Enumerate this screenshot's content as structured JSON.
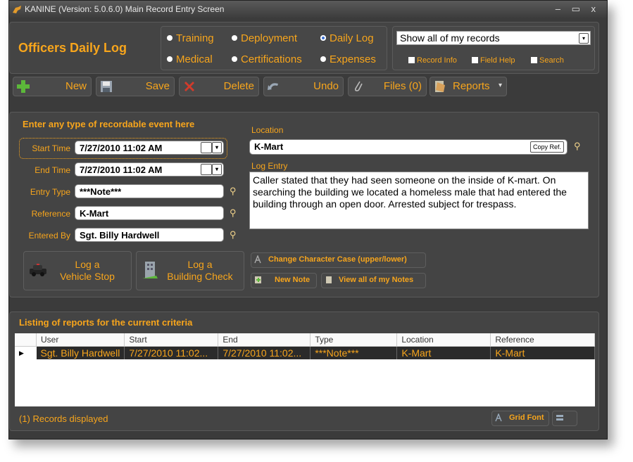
{
  "window": {
    "title": "KANINE (Version: 5.0.6.0) Main Record Entry Screen",
    "controls": "– ▭ x"
  },
  "header": {
    "title": "Officers Daily Log",
    "radios": [
      {
        "label": "Training",
        "selected": false
      },
      {
        "label": "Deployment",
        "selected": false
      },
      {
        "label": "Daily Log",
        "selected": true
      },
      {
        "label": "Medical",
        "selected": false
      },
      {
        "label": "Certifications",
        "selected": false
      },
      {
        "label": "Expenses",
        "selected": false
      }
    ],
    "filter_value": "Show all of my records",
    "checkboxes": [
      "Record Info",
      "Field Help",
      "Search"
    ]
  },
  "toolbar": {
    "new": "New",
    "save": "Save",
    "delete": "Delete",
    "undo": "Undo",
    "files": "Files (0)",
    "reports": "Reports"
  },
  "entry": {
    "heading": "Enter any type of recordable event here",
    "start_time_label": "Start Time",
    "start_time": "7/27/2010 11:02 AM",
    "end_time_label": "End Time",
    "end_time": "7/27/2010 11:02 AM",
    "entry_type_label": "Entry Type",
    "entry_type": "***Note***",
    "reference_label": "Reference",
    "reference": "K-Mart",
    "entered_by_label": "Entered By",
    "entered_by": "Sgt. Billy Hardwell",
    "location_label": "Location",
    "location": "K-Mart",
    "copy_ref": "Copy Ref.",
    "log_entry_label": "Log Entry",
    "log_entry": "Caller stated that they had seen someone on the inside of K-mart. On searching the building we located a homeless male that had entered the building through an open door. Arrested subject for trespass.",
    "vehicle_stop": [
      "Log a",
      "Vehicle Stop"
    ],
    "building_check": [
      "Log a",
      "Building Check"
    ],
    "change_case": "Change Character Case (upper/lower)",
    "new_note": "New Note",
    "view_notes": "View all of my Notes"
  },
  "listing": {
    "heading": "Listing of reports for the current criteria",
    "columns": [
      "User",
      "Start",
      "End",
      "Type",
      "Location",
      "Reference"
    ],
    "rows": [
      [
        "Sgt. Billy Hardwell",
        "7/27/2010 11:02...",
        "7/27/2010 11:02...",
        "***Note***",
        "K-Mart",
        "K-Mart"
      ]
    ],
    "status": "(1) Records displayed",
    "grid_font": "Grid Font"
  }
}
